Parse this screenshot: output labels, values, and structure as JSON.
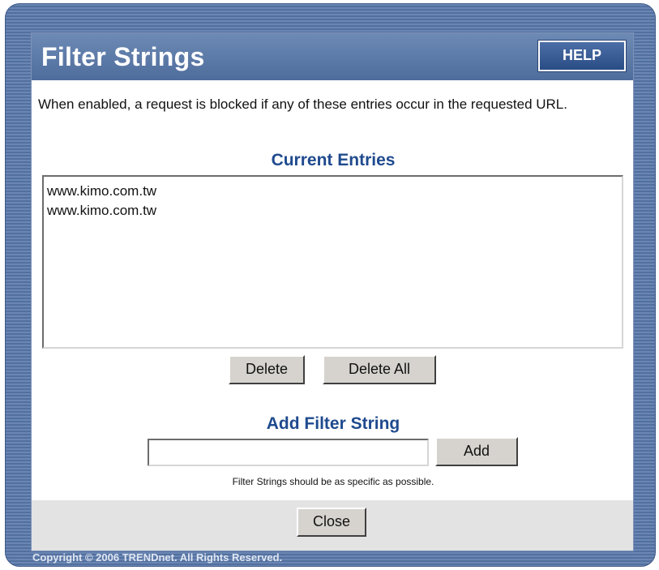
{
  "dialog": {
    "title": "Filter Strings",
    "help_label": "HELP",
    "description": "When enabled, a request is blocked if any of these entries occur in the requested URL."
  },
  "current_entries": {
    "heading": "Current Entries",
    "items": [
      "www.kimo.com.tw",
      "www.kimo.com.tw"
    ],
    "delete_label": "Delete",
    "delete_all_label": "Delete All"
  },
  "add_filter": {
    "heading": "Add Filter String",
    "input_value": "",
    "add_label": "Add",
    "hint": "Filter Strings should be as specific as possible."
  },
  "footer": {
    "close_label": "Close",
    "copyright": "Copyright © 2006 TRENDnet. All Rights Reserved."
  },
  "colors": {
    "frame": "#5a76a4",
    "title_bar": "#5f7daa",
    "heading_text": "#1f4a8e",
    "button_face": "#d6d3ce"
  }
}
